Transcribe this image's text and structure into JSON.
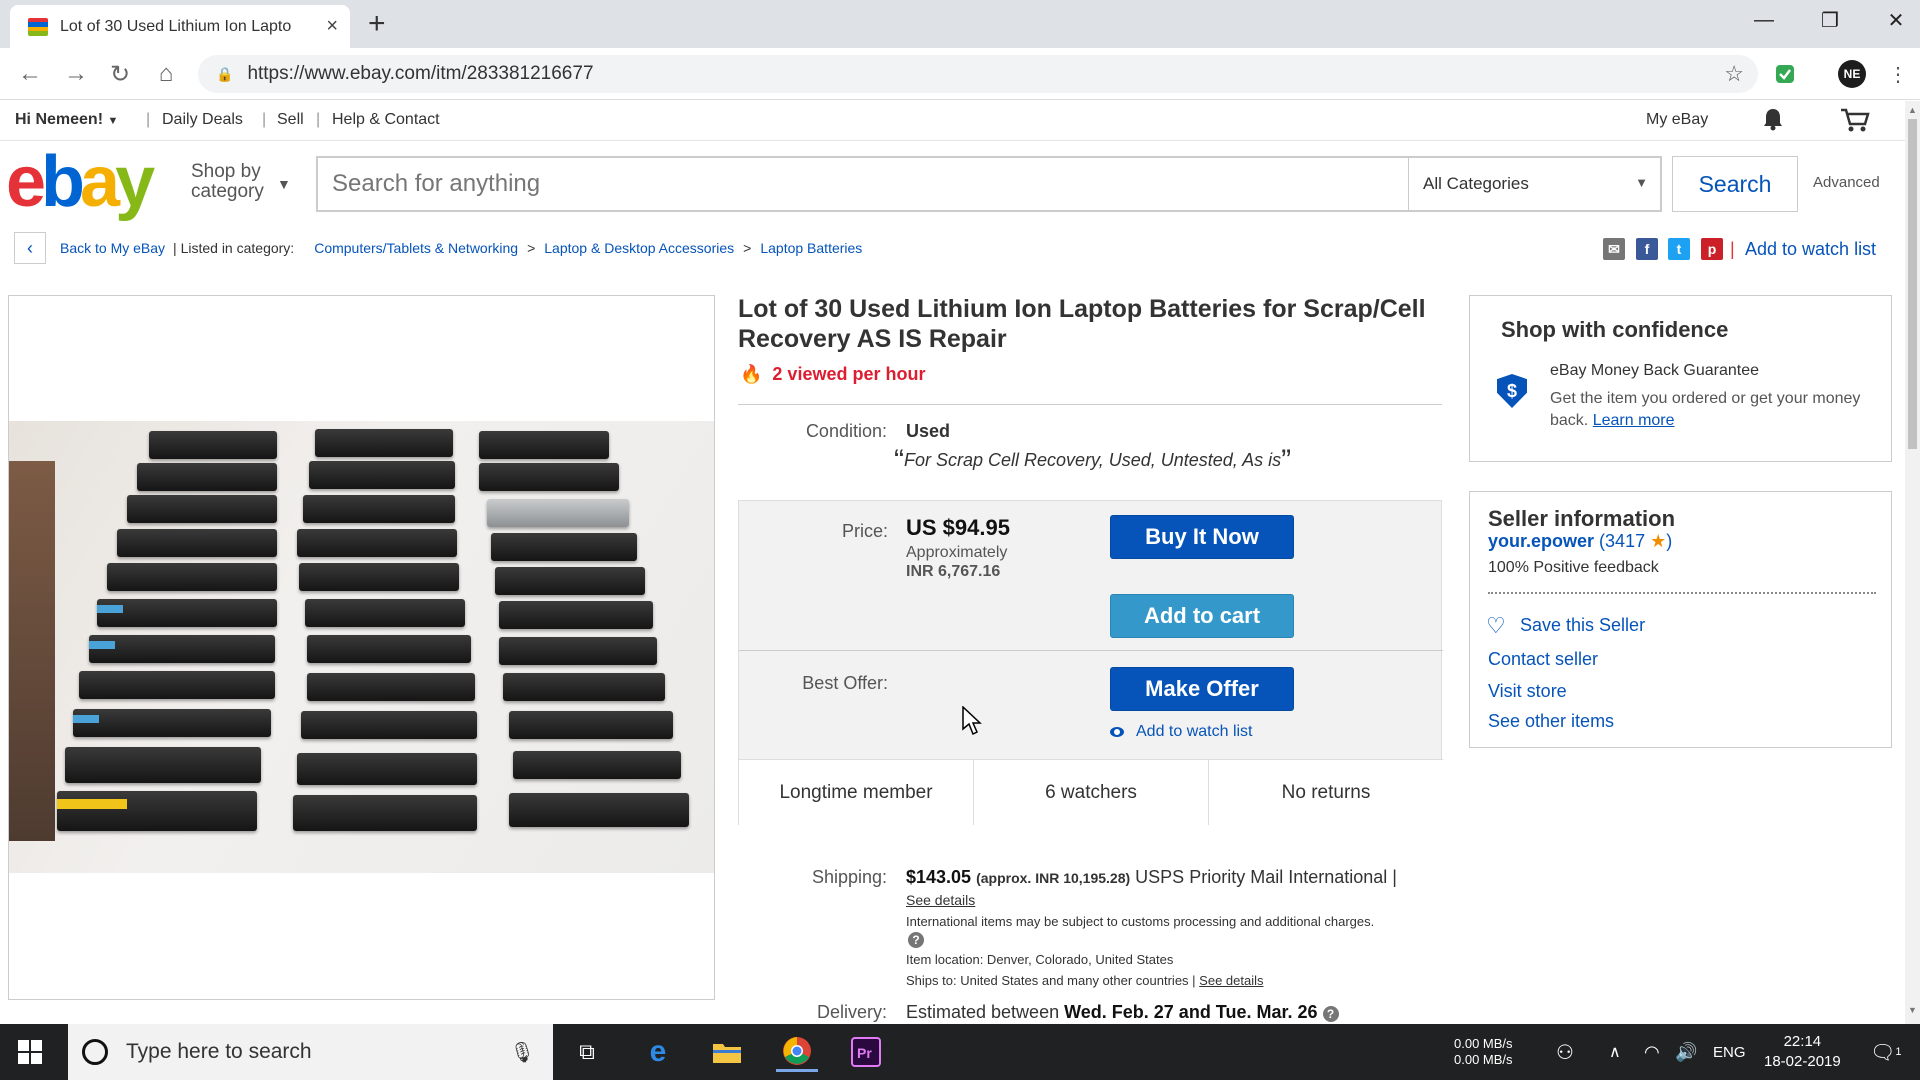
{
  "browser": {
    "tab_title": "Lot of 30 Used Lithium Ion Lapto",
    "new_tab": "+",
    "close_tab": "×",
    "minimize": "—",
    "restore": "❐",
    "close_window": "✕",
    "url": "https://www.ebay.com/itm/283381216677",
    "profile_initials": "NE"
  },
  "topnav": {
    "greeting": "Hi Nemeen!",
    "daily_deals": "Daily Deals",
    "sell": "Sell",
    "help": "Help & Contact",
    "my_ebay": "My eBay"
  },
  "header": {
    "logo": [
      "e",
      "b",
      "a",
      "y"
    ],
    "shop_by_line1": "Shop by",
    "shop_by_line2": "category",
    "search_placeholder": "Search for anything",
    "category": "All Categories",
    "search_button": "Search",
    "advanced": "Advanced"
  },
  "breadcrumb": {
    "back": "Back to My eBay",
    "listed_in": "Listed in category:",
    "items": [
      "Computers/Tablets & Networking",
      "Laptop & Desktop Accessories",
      "Laptop Batteries"
    ],
    "add_to_watch": "Add to watch list"
  },
  "item": {
    "title": "Lot of 30 Used Lithium Ion Laptop Batteries for Scrap/Cell Recovery AS IS Repair",
    "viewed": "2 viewed per hour",
    "condition_label": "Condition:",
    "condition": "Used",
    "condition_desc": "For Scrap Cell Recovery, Used, Untested, As is",
    "price_label": "Price:",
    "price": "US $94.95",
    "approx_line1": "Approximately",
    "approx_line2": "INR 6,767.16",
    "buy_now": "Buy It Now",
    "add_to_cart": "Add to cart",
    "best_offer_label": "Best Offer:",
    "make_offer": "Make Offer",
    "add_to_watch": "Add to watch list",
    "facts": [
      "Longtime member",
      "6 watchers",
      "No returns"
    ],
    "shipping_label": "Shipping:",
    "shipping_price": "$143.05",
    "shipping_approx": "(approx. INR 10,195.28)",
    "shipping_method": "USPS Priority Mail International |",
    "see_details": "See details",
    "intl_note": "International items may be subject to customs processing and additional charges.",
    "item_location": "Item location:  Denver, Colorado, United States",
    "ships_to": "Ships to:  United States and many other countries |",
    "ships_details": "See details",
    "delivery_label": "Delivery:",
    "delivery_prefix": "Estimated between",
    "delivery_range": "Wed. Feb. 27 and Tue. Mar. 26"
  },
  "confidence": {
    "title": "Shop with confidence",
    "mbg_title": "eBay Money Back Guarantee",
    "mbg_desc": "Get the item you ordered or get your money back.",
    "learn_more": "Learn more"
  },
  "seller": {
    "title": "Seller information",
    "name": "your.epower",
    "feedback": "(3417",
    "feedback_close": ")",
    "positive": "100% Positive feedback",
    "save": "Save this Seller",
    "contact": "Contact seller",
    "visit": "Visit store",
    "other": "See other items"
  },
  "taskbar": {
    "search_placeholder": "Type here to search",
    "net_up": "0.00 MB/s",
    "net_down": "0.00 MB/s",
    "lang": "ENG",
    "time": "22:14",
    "date": "18-02-2019",
    "notif_count": "1"
  },
  "colors": {
    "ebay_blue": "#0654ba",
    "buy_now": "#0654ba",
    "add_to_cart": "#3498ca",
    "alert_red": "#dd1e31"
  }
}
